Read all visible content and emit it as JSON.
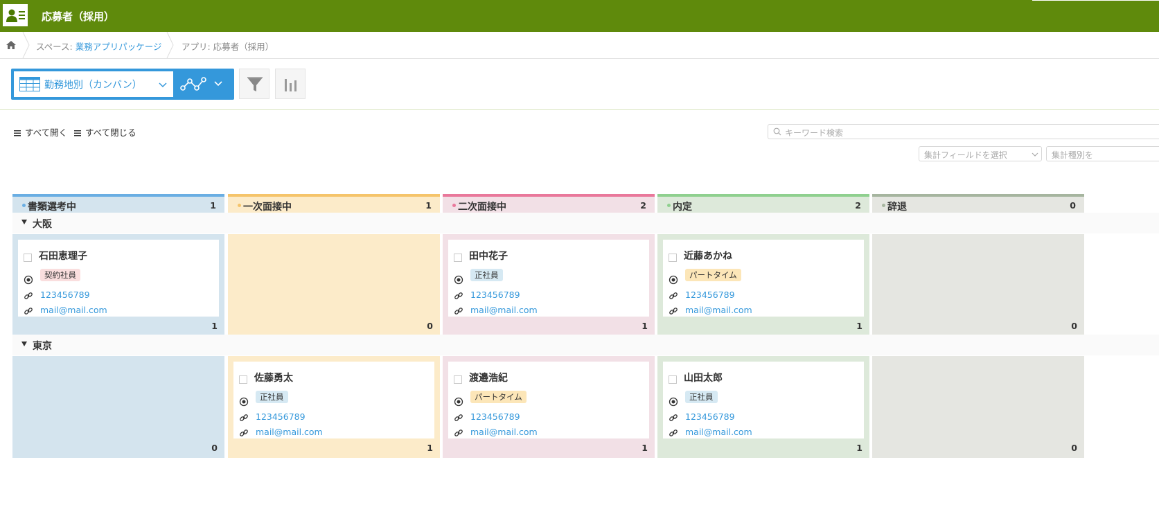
{
  "header": {
    "title": "応募者（採用）",
    "bg_color": "#5f8a0c"
  },
  "breadcrumb": {
    "space_prefix": "スペース: ",
    "space_name": "業務アプリパッケージ",
    "app_text": "アプリ: 応募者（採用）"
  },
  "toolbar": {
    "view_label": "勤務地別（カンバン）",
    "view_color": "#3498db",
    "graph_icon": "graph-icon",
    "filter_icon": "filter-icon",
    "chart_icon": "bar-chart-icon"
  },
  "controls": {
    "expand_all": "すべて開く",
    "collapse_all": "すべて閉じる",
    "search_placeholder": "キーワード検索",
    "agg_field_placeholder": "集計フィールドを選択",
    "agg_type_placeholder": "集計種別を"
  },
  "columns": [
    {
      "title": "書類選考中",
      "count": "1",
      "accent": "#6aaee3",
      "bg": "#d4e4ee"
    },
    {
      "title": "一次面接中",
      "count": "1",
      "accent": "#f5c46a",
      "bg": "#fcebc9"
    },
    {
      "title": "二次面接中",
      "count": "2",
      "accent": "#e9789b",
      "bg": "#f2e0e6"
    },
    {
      "title": "内定",
      "count": "2",
      "accent": "#8fd08f",
      "bg": "#dde9da"
    },
    {
      "title": "辞退",
      "count": "0",
      "accent": "#a6b59f",
      "bg": "#e5e6e1"
    }
  ],
  "groups": [
    {
      "label": "大阪",
      "lane_counts": [
        "1",
        "0",
        "1",
        "1",
        "0"
      ],
      "cards": [
        {
          "name": "石田恵理子",
          "tag": "契約社員",
          "tag_bg": "#fadede",
          "phone": "123456789",
          "email": "mail@mail.com"
        },
        {
          "name": "田中花子",
          "tag": "正社員",
          "tag_bg": "#d6e9f3",
          "phone": "123456789",
          "email": "mail@mail.com"
        },
        {
          "name": "近藤あかね",
          "tag": "パートタイム",
          "tag_bg": "#fce6b8",
          "phone": "123456789",
          "email": "mail@mail.com"
        }
      ]
    },
    {
      "label": "東京",
      "lane_counts": [
        "0",
        "1",
        "1",
        "1",
        "0"
      ],
      "cards": [
        {
          "name": "佐藤勇太",
          "tag": "正社員",
          "tag_bg": "#d6e9f3",
          "phone": "123456789",
          "email": "mail@mail.com"
        },
        {
          "name": "渡邉浩紀",
          "tag": "パートタイム",
          "tag_bg": "#fce6b8",
          "phone": "123456789",
          "email": "mail@mail.com"
        },
        {
          "name": "山田太郎",
          "tag": "正社員",
          "tag_bg": "#d6e9f3",
          "phone": "123456789",
          "email": "mail@mail.com"
        }
      ]
    }
  ]
}
